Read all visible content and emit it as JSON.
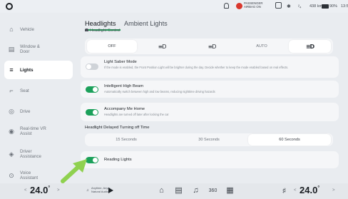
{
  "status_bar": {
    "airbag_line1": "PASSENGER",
    "airbag_line2": "AIRBAG ON",
    "signal": "²₄",
    "range": "438 km",
    "battery": "90%",
    "time": "13:54"
  },
  "sidebar": {
    "items": [
      {
        "label": "Vehicle",
        "icon": "⌂"
      },
      {
        "label": "Window &\nDoor",
        "icon": "▤"
      },
      {
        "label": "Lights",
        "icon": "≡"
      },
      {
        "label": "Seat",
        "icon": "⌐"
      },
      {
        "label": "Drive",
        "icon": "◎"
      },
      {
        "label": "Real-time VR\nAssist",
        "icon": "◉"
      },
      {
        "label": "Driver\nAssistance",
        "icon": "◈"
      },
      {
        "label": "Voice\nAssistant",
        "icon": "⊙"
      }
    ]
  },
  "tabs": {
    "headlights": "Headlights",
    "ambient": "Ambient Lights"
  },
  "headlight_control": {
    "title": "Headlight Control",
    "options": [
      "OFF",
      "≡D",
      "≡D",
      "AUTO",
      "≡D"
    ]
  },
  "settings": {
    "light_saber": {
      "title": "Light Saber Mode",
      "desc": "If the mode is enabled, the Front Position Light will be brighter during the day. Decide whether to keep the mode enabled based on real effects."
    },
    "high_beam": {
      "title": "Intelligent High Beam",
      "desc": "Automatically switch between high and low beams, reducing nighttime driving hazards"
    },
    "accompany": {
      "title": "Accompany Me Home",
      "desc": "Headlights are turned off later after locking the car"
    },
    "delay": {
      "label": "Headlight Delayed Turning off Time",
      "options": [
        "15 Seconds",
        "30 Seconds",
        "60 Seconds"
      ]
    },
    "reading": {
      "title": "Reading Lights"
    }
  },
  "bottom_bar": {
    "temp_left": "24.0",
    "temp_right": "24.0",
    "unit": "°",
    "media_line1": "Anytime, Anyw..",
    "media_line2": "Natural Audio"
  },
  "colors": {
    "accent_green": "#1ba05a",
    "arrow_green": "#8fd14f"
  }
}
